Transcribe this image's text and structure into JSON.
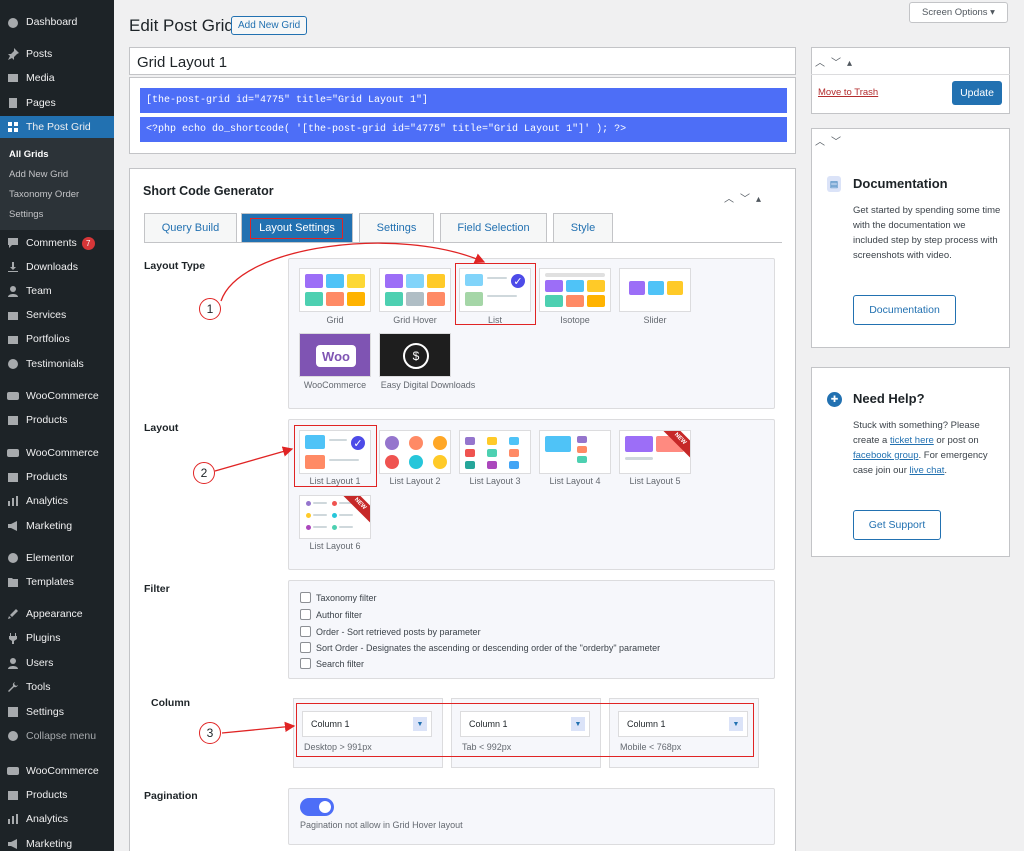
{
  "sidebar": {
    "dashboard": "Dashboard",
    "posts": "Posts",
    "media": "Media",
    "pages": "Pages",
    "the_post_grid": "The Post Grid",
    "sub": {
      "all_grids": "All Grids",
      "add_new": "Add New Grid",
      "taxonomy": "Taxonomy Order",
      "settings": "Settings"
    },
    "comments": "Comments",
    "comments_count": "7",
    "downloads": "Downloads",
    "team": "Team",
    "services": "Services",
    "portfolios": "Portfolios",
    "testimonials": "Testimonials",
    "woo1": "WooCommerce",
    "products1": "Products",
    "woo2": "WooCommerce",
    "products2": "Products",
    "analytics1": "Analytics",
    "marketing1": "Marketing",
    "elementor": "Elementor",
    "templates": "Templates",
    "appearance": "Appearance",
    "plugins": "Plugins",
    "users": "Users",
    "tools": "Tools",
    "settings": "Settings",
    "collapse": "Collapse menu",
    "woo3": "WooCommerce",
    "products3": "Products",
    "analytics2": "Analytics",
    "marketing2": "Marketing"
  },
  "header": {
    "title": "Edit Post Grid",
    "add_new": "Add New Grid",
    "screen_options": "Screen Options ▾"
  },
  "post_title": "Grid Layout 1",
  "shortcode": "[the-post-grid id=\"4775\" title=\"Grid Layout 1\"]",
  "php_code": "<?php echo do_shortcode( '[the-post-grid id=\"4775\" title=\"Grid Layout 1\"]' ); ?>",
  "generator": {
    "title": "Short Code Generator",
    "tabs": [
      "Query Build",
      "Layout Settings",
      "Settings",
      "Field Selection",
      "Style"
    ]
  },
  "layout_type": {
    "label": "Layout Type",
    "items": [
      "Grid",
      "Grid Hover",
      "List",
      "Isotope",
      "Slider",
      "WooCommerce",
      "Easy Digital Downloads"
    ],
    "woo_logo": "Woo",
    "edd_symbol": "$"
  },
  "layout": {
    "label": "Layout",
    "items": [
      "List Layout 1",
      "List Layout 2",
      "List Layout 3",
      "List Layout 4",
      "List Layout 5",
      "List Layout 6"
    ],
    "new_badge": "NEW"
  },
  "filter": {
    "label": "Filter",
    "items": [
      "Taxonomy filter",
      "Author filter",
      "Order - Sort retrieved posts by parameter",
      "Sort Order - Designates the ascending or descending order of the \"orderby\" parameter",
      "Search filter"
    ]
  },
  "column": {
    "label": "Column",
    "items": [
      {
        "value": "Column 1",
        "caption": "Desktop > 991px"
      },
      {
        "value": "Column 1",
        "caption": "Tab < 992px"
      },
      {
        "value": "Column 1",
        "caption": "Mobile < 768px"
      }
    ]
  },
  "pagination": {
    "label": "Pagination",
    "note": "Pagination not allow in Grid Hover layout"
  },
  "annotations": [
    "1",
    "2",
    "3"
  ],
  "publish": {
    "trash": "Move to Trash",
    "update": "Update"
  },
  "documentation": {
    "title": "Documentation",
    "text": "Get started by spending some time with the documentation we included step by step process with screenshots with video.",
    "button": "Documentation"
  },
  "help": {
    "title": "Need Help?",
    "text1": "Stuck with something? Please create a ",
    "link1": "ticket here",
    "text2": " or post on ",
    "link2": "facebook group",
    "text3": ". For emergency case join our ",
    "link3": "live chat",
    "text4": ".",
    "button": "Get Support"
  },
  "colors": {
    "accent": "#2271b1",
    "shortcode_bg": "#4d6ef7",
    "sidebar_bg": "#1d2327",
    "annotation": "#e02424"
  }
}
